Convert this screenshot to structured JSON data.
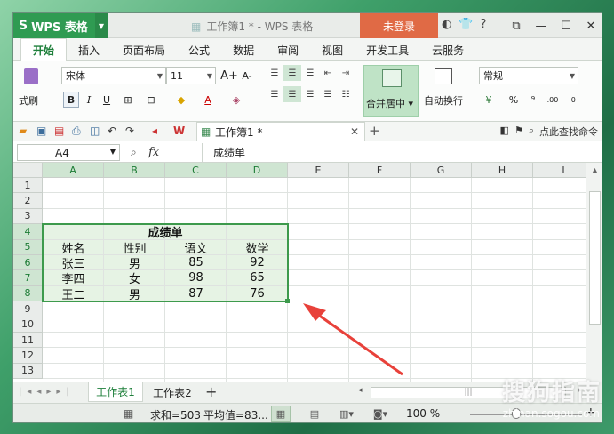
{
  "app": {
    "name": "WPS 表格",
    "document_title": "工作簿1 * - WPS 表格",
    "login_label": "未登录",
    "help_label": "?"
  },
  "menu": {
    "tabs": [
      "开始",
      "插入",
      "页面布局",
      "公式",
      "数据",
      "审阅",
      "视图",
      "开发工具",
      "云服务"
    ],
    "active": "开始"
  },
  "ribbon": {
    "format_painter_label": "式刷",
    "font_name": "宋体",
    "font_size": "11",
    "grow_font": "A+",
    "shrink_font": "A-",
    "bold": "B",
    "italic": "I",
    "underline": "U",
    "merge_label": "合并居中",
    "wrap_label": "自动换行",
    "number_format": "常规",
    "percent": "%",
    "comma": "⁹"
  },
  "quickbar": {
    "doc_tab": "工作簿1 *",
    "find_label": "点此查找命令"
  },
  "formula_bar": {
    "name_box": "A4",
    "fx": "fx",
    "content": "成绩单"
  },
  "sheet": {
    "columns": [
      "A",
      "B",
      "C",
      "D",
      "E",
      "F",
      "G",
      "H",
      "I"
    ],
    "rows": [
      "1",
      "2",
      "3",
      "4",
      "5",
      "6",
      "7",
      "8",
      "9",
      "10",
      "11",
      "12",
      "13"
    ],
    "selected_columns": [
      "A",
      "B",
      "C",
      "D"
    ],
    "selected_rows": [
      "4",
      "5",
      "6",
      "7",
      "8"
    ],
    "table_title": "成绩单",
    "headers": [
      "姓名",
      "性别",
      "语文",
      "数学"
    ],
    "data": [
      [
        "张三",
        "男",
        "85",
        "92"
      ],
      [
        "李四",
        "女",
        "98",
        "65"
      ],
      [
        "王二",
        "男",
        "87",
        "76"
      ]
    ]
  },
  "sheet_tabs": [
    "工作表1",
    "工作表2"
  ],
  "active_sheet": "工作表1",
  "status": {
    "sum": "求和=503",
    "avg": "平均值=83...",
    "zoom": "100 %",
    "zoom_minus": "—",
    "zoom_plus": "+"
  },
  "watermark": {
    "brand": "搜狗指南",
    "url": "zhinan.sogou.com"
  },
  "colors": {
    "accent": "#2f9b52",
    "login": "#e06a45",
    "selection_border": "#3d9a4c",
    "selection_fill": "#e6f3e4",
    "annotation_arrow": "#e8413a"
  }
}
